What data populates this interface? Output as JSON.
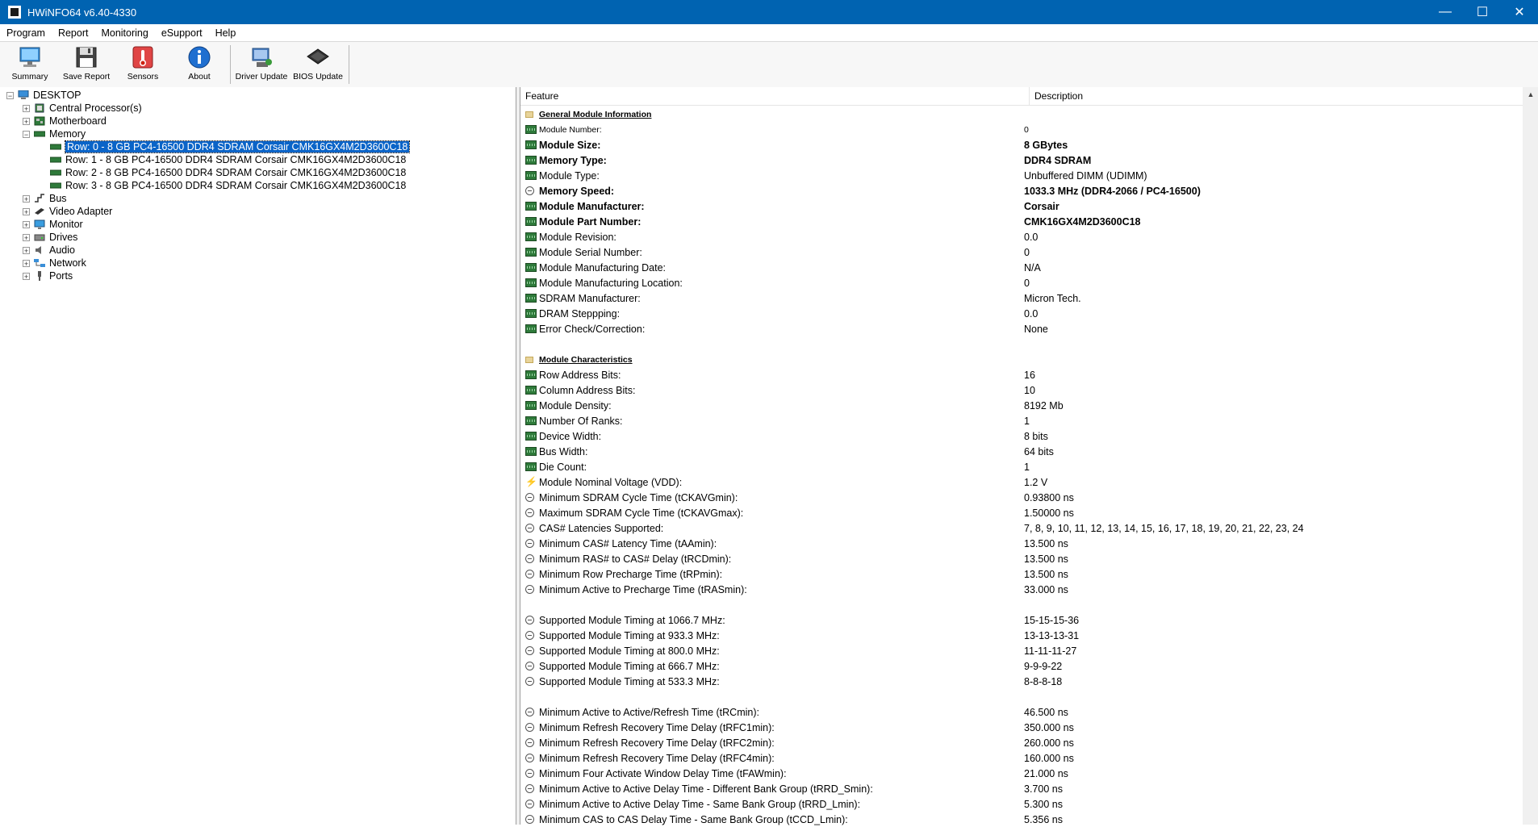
{
  "window": {
    "title": "HWiNFO64 v6.40-4330",
    "minimize": "—",
    "maximize": "☐",
    "close": "✕"
  },
  "menu": [
    "Program",
    "Report",
    "Monitoring",
    "eSupport",
    "Help"
  ],
  "toolbar": {
    "summary": "Summary",
    "save_report": "Save Report",
    "sensors": "Sensors",
    "about": "About",
    "driver_update": "Driver Update",
    "bios_update": "BIOS Update"
  },
  "tree": {
    "root": "DESKTOP",
    "cpu": "Central Processor(s)",
    "motherboard": "Motherboard",
    "memory": "Memory",
    "memory_rows": [
      "Row: 0 - 8 GB PC4-16500 DDR4 SDRAM Corsair CMK16GX4M2D3600C18",
      "Row: 1 - 8 GB PC4-16500 DDR4 SDRAM Corsair CMK16GX4M2D3600C18",
      "Row: 2 - 8 GB PC4-16500 DDR4 SDRAM Corsair CMK16GX4M2D3600C18",
      "Row: 3 - 8 GB PC4-16500 DDR4 SDRAM Corsair CMK16GX4M2D3600C18"
    ],
    "bus": "Bus",
    "video": "Video Adapter",
    "monitor": "Monitor",
    "drives": "Drives",
    "audio": "Audio",
    "network": "Network",
    "ports": "Ports"
  },
  "details": {
    "header_feature": "Feature",
    "header_description": "Description",
    "rows": [
      {
        "type": "section",
        "feature": "General Module Information",
        "value": ""
      },
      {
        "type": "small",
        "icon": "mem",
        "feature": "Module Number:",
        "value": "0"
      },
      {
        "type": "bold",
        "icon": "mem",
        "feature": "Module Size:",
        "value": "8 GBytes"
      },
      {
        "type": "bold",
        "icon": "mem",
        "feature": "Memory Type:",
        "value": "DDR4 SDRAM"
      },
      {
        "type": "normal",
        "icon": "mem",
        "feature": "Module Type:",
        "value": "Unbuffered DIMM (UDIMM)"
      },
      {
        "type": "bold",
        "icon": "clock",
        "feature": "Memory Speed:",
        "value": "1033.3 MHz (DDR4-2066 / PC4-16500)"
      },
      {
        "type": "bold",
        "icon": "mem",
        "feature": "Module Manufacturer:",
        "value": "Corsair"
      },
      {
        "type": "bold",
        "icon": "mem",
        "feature": "Module Part Number:",
        "value": "CMK16GX4M2D3600C18"
      },
      {
        "type": "normal",
        "icon": "mem",
        "feature": "Module Revision:",
        "value": "0.0"
      },
      {
        "type": "normal",
        "icon": "mem",
        "feature": "Module Serial Number:",
        "value": "0"
      },
      {
        "type": "normal",
        "icon": "mem",
        "feature": "Module Manufacturing Date:",
        "value": "N/A"
      },
      {
        "type": "normal",
        "icon": "mem",
        "feature": "Module Manufacturing Location:",
        "value": "0"
      },
      {
        "type": "normal",
        "icon": "mem",
        "feature": "SDRAM Manufacturer:",
        "value": "Micron Tech."
      },
      {
        "type": "normal",
        "icon": "mem",
        "feature": "DRAM Steppping:",
        "value": "0.0"
      },
      {
        "type": "normal",
        "icon": "mem",
        "feature": "Error Check/Correction:",
        "value": "None"
      },
      {
        "type": "blank",
        "feature": "",
        "value": ""
      },
      {
        "type": "section",
        "feature": "Module Characteristics",
        "value": ""
      },
      {
        "type": "normal",
        "icon": "mem",
        "feature": "Row Address Bits:",
        "value": "16"
      },
      {
        "type": "normal",
        "icon": "mem",
        "feature": "Column Address Bits:",
        "value": "10"
      },
      {
        "type": "normal",
        "icon": "mem",
        "feature": "Module Density:",
        "value": "8192 Mb"
      },
      {
        "type": "normal",
        "icon": "mem",
        "feature": "Number Of Ranks:",
        "value": "1"
      },
      {
        "type": "normal",
        "icon": "mem",
        "feature": "Device Width:",
        "value": "8 bits"
      },
      {
        "type": "normal",
        "icon": "mem",
        "feature": "Bus Width:",
        "value": "64 bits"
      },
      {
        "type": "normal",
        "icon": "mem",
        "feature": "Die Count:",
        "value": "1"
      },
      {
        "type": "normal",
        "icon": "volt",
        "feature": "Module Nominal Voltage (VDD):",
        "value": "1.2 V"
      },
      {
        "type": "normal",
        "icon": "clock",
        "feature": "Minimum SDRAM Cycle Time (tCKAVGmin):",
        "value": "0.93800 ns"
      },
      {
        "type": "normal",
        "icon": "clock",
        "feature": "Maximum SDRAM Cycle Time (tCKAVGmax):",
        "value": "1.50000 ns"
      },
      {
        "type": "normal",
        "icon": "clock",
        "feature": "CAS# Latencies Supported:",
        "value": "7, 8, 9, 10, 11, 12, 13, 14, 15, 16, 17, 18, 19, 20, 21, 22, 23, 24"
      },
      {
        "type": "normal",
        "icon": "clock",
        "feature": "Minimum CAS# Latency Time (tAAmin):",
        "value": "13.500 ns"
      },
      {
        "type": "normal",
        "icon": "clock",
        "feature": "Minimum RAS# to CAS# Delay (tRCDmin):",
        "value": "13.500 ns"
      },
      {
        "type": "normal",
        "icon": "clock",
        "feature": "Minimum Row Precharge Time (tRPmin):",
        "value": "13.500 ns"
      },
      {
        "type": "normal",
        "icon": "clock",
        "feature": "Minimum Active to Precharge Time (tRASmin):",
        "value": "33.000 ns"
      },
      {
        "type": "blank",
        "feature": "",
        "value": ""
      },
      {
        "type": "normal",
        "icon": "clock",
        "feature": "Supported Module Timing at 1066.7 MHz:",
        "value": "15-15-15-36"
      },
      {
        "type": "normal",
        "icon": "clock",
        "feature": "Supported Module Timing at 933.3 MHz:",
        "value": "13-13-13-31"
      },
      {
        "type": "normal",
        "icon": "clock",
        "feature": "Supported Module Timing at 800.0 MHz:",
        "value": "11-11-11-27"
      },
      {
        "type": "normal",
        "icon": "clock",
        "feature": "Supported Module Timing at 666.7 MHz:",
        "value": "9-9-9-22"
      },
      {
        "type": "normal",
        "icon": "clock",
        "feature": "Supported Module Timing at 533.3 MHz:",
        "value": "8-8-8-18"
      },
      {
        "type": "blank",
        "feature": "",
        "value": ""
      },
      {
        "type": "normal",
        "icon": "clock",
        "feature": "Minimum Active to Active/Refresh Time (tRCmin):",
        "value": "46.500 ns"
      },
      {
        "type": "normal",
        "icon": "clock",
        "feature": "Minimum Refresh Recovery Time Delay (tRFC1min):",
        "value": "350.000 ns"
      },
      {
        "type": "normal",
        "icon": "clock",
        "feature": "Minimum Refresh Recovery Time Delay (tRFC2min):",
        "value": "260.000 ns"
      },
      {
        "type": "normal",
        "icon": "clock",
        "feature": "Minimum Refresh Recovery Time Delay (tRFC4min):",
        "value": "160.000 ns"
      },
      {
        "type": "normal",
        "icon": "clock",
        "feature": "Minimum Four Activate Window Delay Time (tFAWmin):",
        "value": "21.000 ns"
      },
      {
        "type": "normal",
        "icon": "clock",
        "feature": "Minimum Active to Active Delay Time - Different Bank Group (tRRD_Smin):",
        "value": "3.700 ns"
      },
      {
        "type": "normal",
        "icon": "clock",
        "feature": "Minimum Active to Active Delay Time - Same Bank Group (tRRD_Lmin):",
        "value": "5.300 ns"
      },
      {
        "type": "normal",
        "icon": "clock",
        "feature": "Minimum CAS to CAS Delay Time - Same Bank Group (tCCD_Lmin):",
        "value": "5.356 ns"
      }
    ]
  }
}
